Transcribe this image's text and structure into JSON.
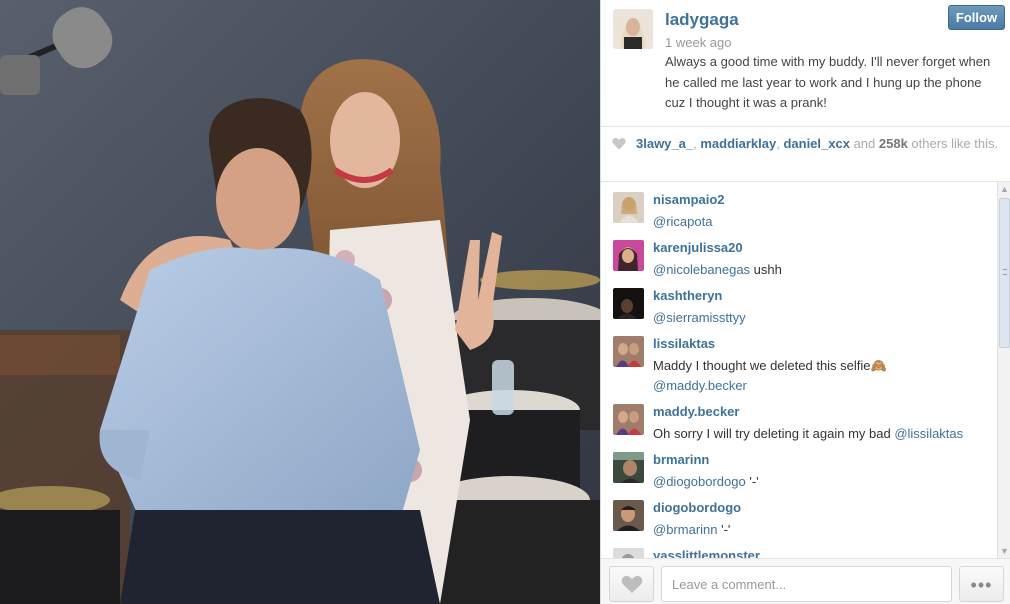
{
  "post": {
    "username": "ladygaga",
    "time_ago": "1 week ago",
    "follow_label": "Follow",
    "caption": "Always a good time with my buddy. I'll never forget when he called me last year to work and I hung up the phone cuz I thought it was a prank!"
  },
  "likes": {
    "users": [
      "3lawy_a_",
      "maddiarklay",
      "daniel_xcx"
    ],
    "sep1": ", ",
    "sep2": ", ",
    "and_text": " and ",
    "count": "258k",
    "suffix": " others like this."
  },
  "comments": [
    {
      "user": "nisampaio2",
      "mention": "@ricapota",
      "text": ""
    },
    {
      "user": "karenjulissa20",
      "mention": "@nicolebanegas",
      "text": " ushh"
    },
    {
      "user": "kashtheryn",
      "mention": "@sierramissttyy",
      "text": ""
    },
    {
      "user": "lissilaktas",
      "line1": "Maddy I thought we deleted this selfie🙈",
      "mention": "@maddy.becker"
    },
    {
      "user": "maddy.becker",
      "text": "Oh sorry I will try deleting it again my bad ",
      "mention": "@lissilaktas"
    },
    {
      "user": "brmarinn",
      "mention": "@diogobordogo",
      "text": " '-'"
    },
    {
      "user": "diogobordogo",
      "mention": "@brmarinn",
      "text": " '-'"
    },
    {
      "user": "yasslittlemonster"
    }
  ],
  "footer": {
    "comment_placeholder": "Leave a comment...",
    "more_label": "•••"
  },
  "icons": {
    "heart": "heart-icon",
    "more": "ellipsis-icon",
    "scroll_up": "▲",
    "scroll_down": "▼"
  },
  "colors": {
    "username_link": "#3f729b",
    "follow_button": "#4a7aa3"
  }
}
